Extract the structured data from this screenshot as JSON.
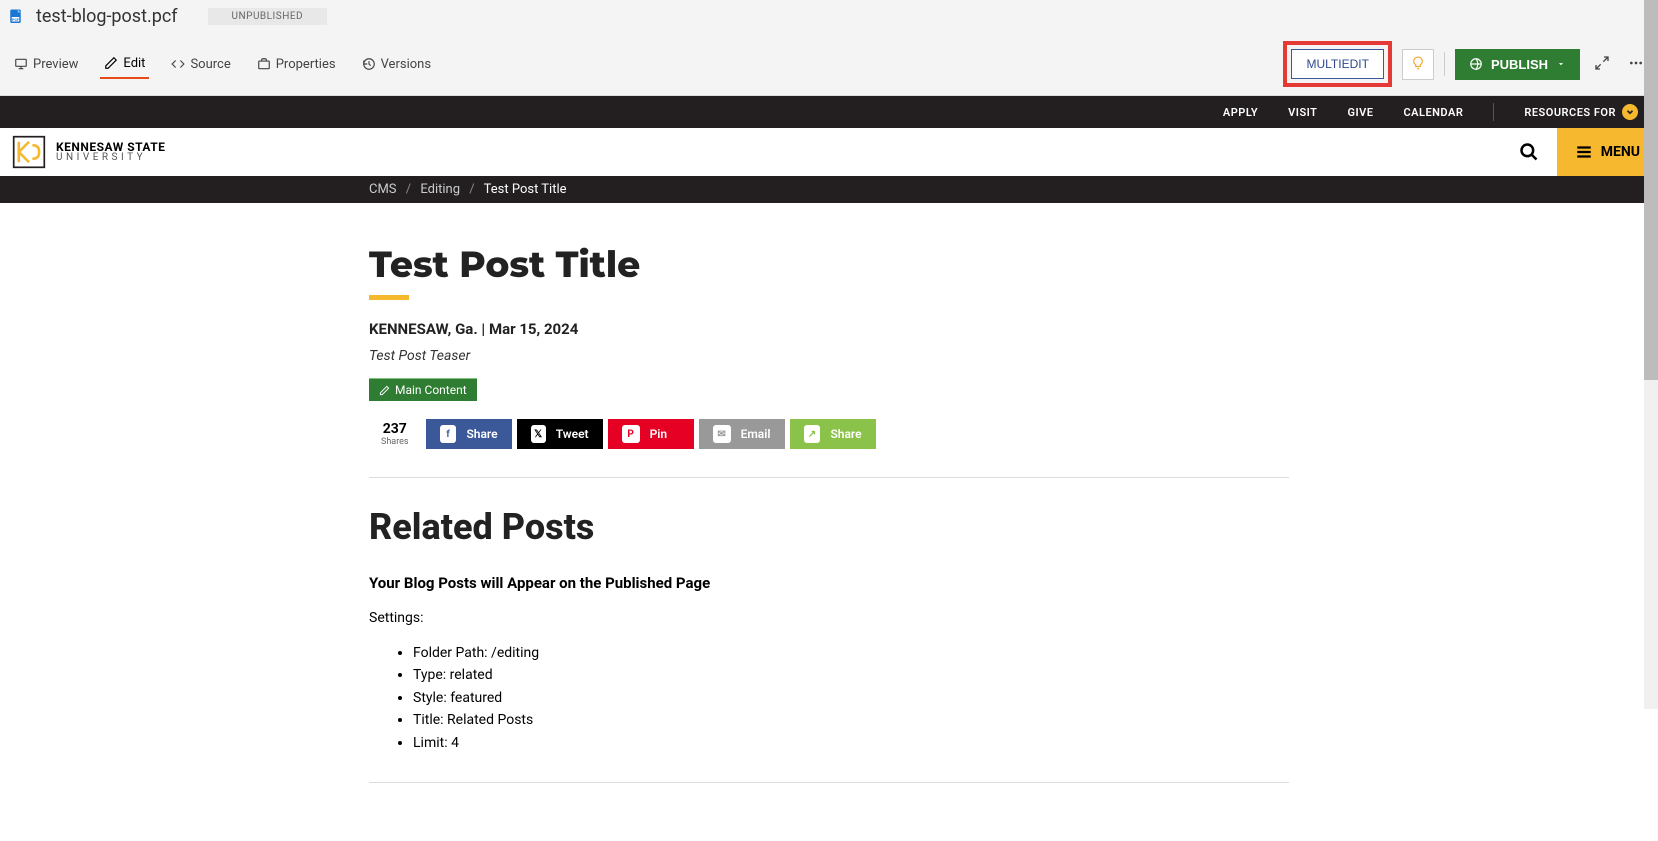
{
  "file": {
    "name": "test-blog-post.pcf",
    "status": "UNPUBLISHED"
  },
  "toolbar": {
    "preview": "Preview",
    "edit": "Edit",
    "source": "Source",
    "properties": "Properties",
    "versions": "Versions",
    "multiedit": "MULTIEDIT",
    "publish": "PUBLISH"
  },
  "utility_nav": {
    "apply": "APPLY",
    "visit": "VISIT",
    "give": "GIVE",
    "calendar": "CALENDAR",
    "resources_for": "RESOURCES FOR"
  },
  "brand": {
    "top": "KENNESAW STATE",
    "bottom": "UNIVERSITY"
  },
  "menu_label": "MENU",
  "breadcrumb": {
    "items": [
      "CMS",
      "Editing",
      "Test Post Title"
    ]
  },
  "post": {
    "title": "Test Post Title",
    "location": "KENNESAW, Ga.",
    "date": "Mar 15, 2024",
    "teaser": "Test Post Teaser",
    "edit_region": "Main Content"
  },
  "shares": {
    "count": "237",
    "label": "Shares",
    "buttons": {
      "facebook": "Share",
      "twitter": "Tweet",
      "pinterest": "Pin",
      "email": "Email",
      "share": "Share"
    }
  },
  "related": {
    "title": "Related Posts",
    "subtitle": "Your Blog Posts will Appear on the Published Page",
    "settings_label": "Settings:",
    "settings": [
      "Folder Path: /editing",
      "Type: related",
      "Style: featured",
      "Title: Related Posts",
      "Limit: 4"
    ]
  }
}
